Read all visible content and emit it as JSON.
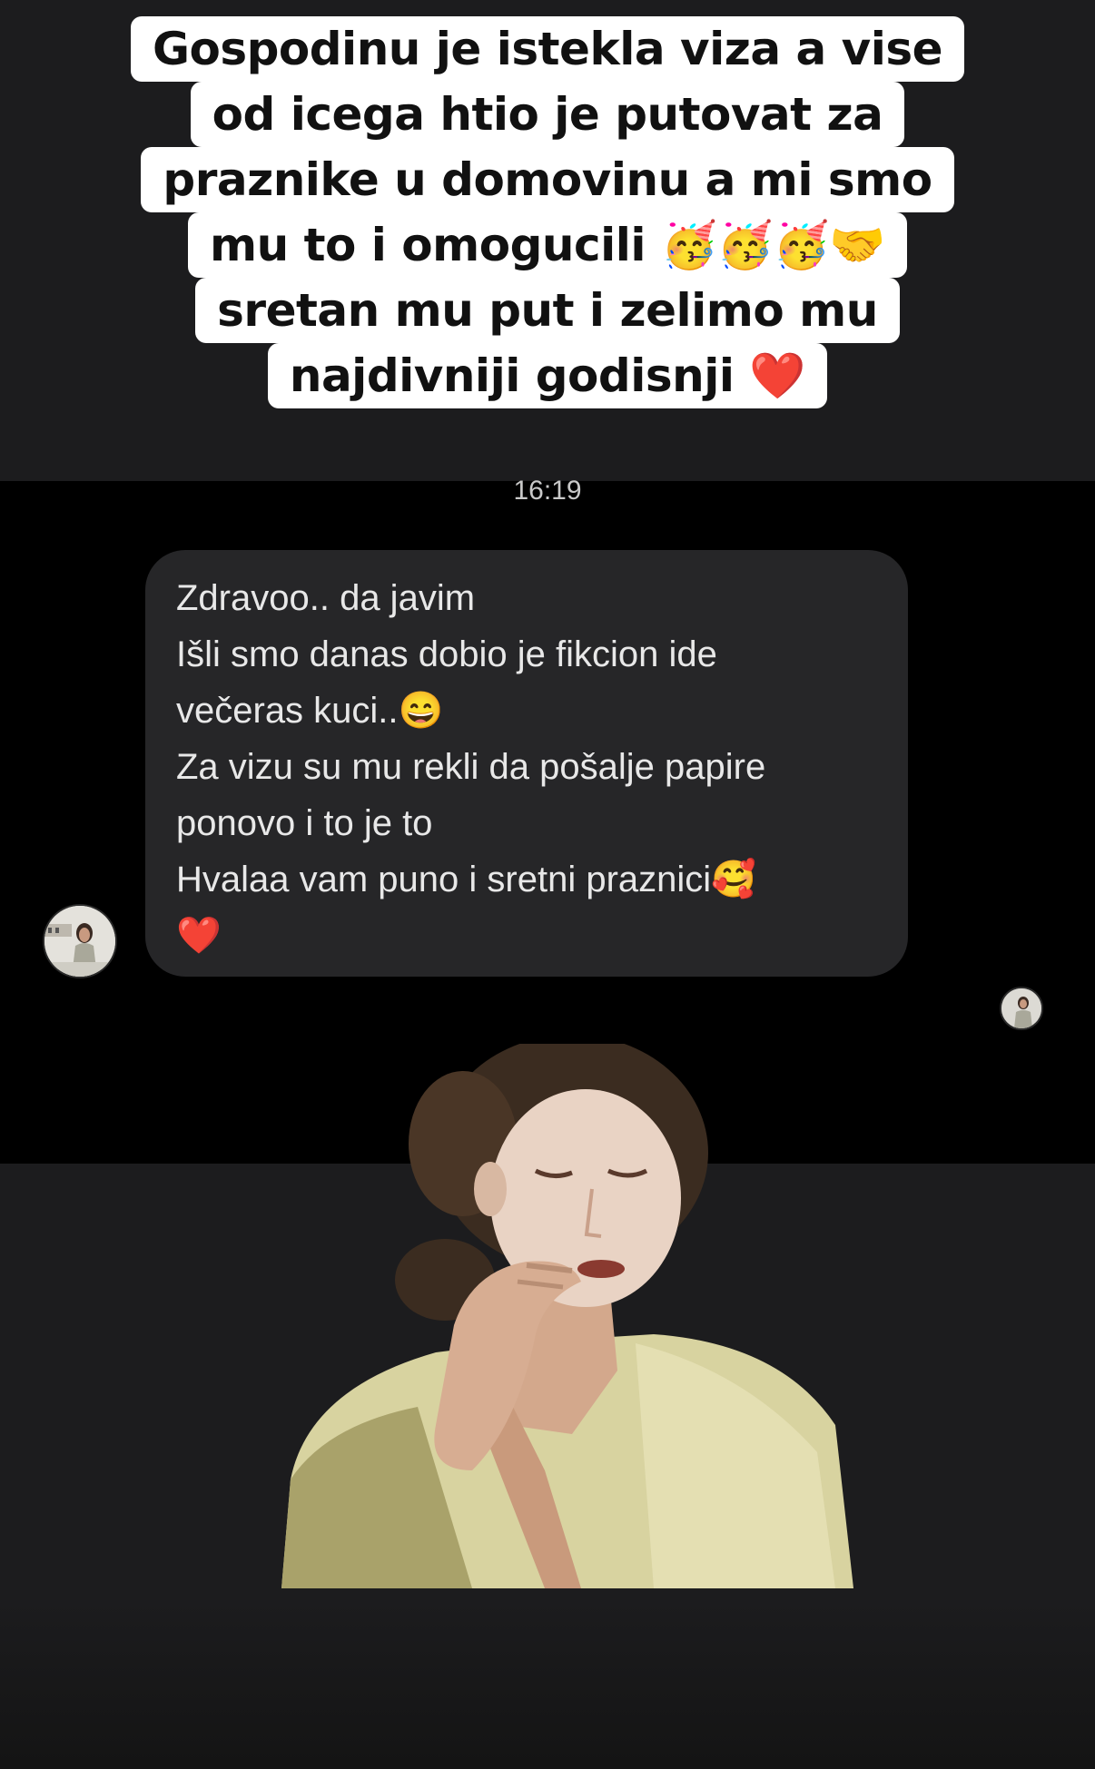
{
  "caption": {
    "lines": [
      "Gospodinu je istekla viza a vise",
      "od icega htio je putovat za",
      "praznike u domovinu a mi smo",
      "mu to i omogucili",
      "sretan mu put i zelimo mu",
      "najdivniji godisnji"
    ],
    "line4_emojis": [
      "🥳",
      "🥳",
      "🥳",
      "🤝"
    ],
    "line6_emoji": "❤️"
  },
  "conversation": {
    "timestamp": "16:19",
    "message": {
      "lines": [
        "Zdravoo.. da javim",
        "Išli smo danas dobio je fikcion ide",
        "večeras kuci..",
        "Za vizu su mu rekli da pošalje papire",
        "ponovo i to je to",
        "Hvalaa vam puno i sretni praznici"
      ],
      "emoji_line3": "😄",
      "emoji_line6": "🥰",
      "emoji_last": "❤️"
    }
  },
  "icons": {
    "sender_avatar": "avatar-photo",
    "seen_avatar": "seen-avatar-photo",
    "sticker": "gif-sticker-woman-applying-makeup"
  },
  "colors": {
    "story_background": "#1c1c1e",
    "chat_background": "#000000",
    "bubble": "#262628",
    "caption_highlight": "#ffffff",
    "heart": "#e0102a"
  }
}
